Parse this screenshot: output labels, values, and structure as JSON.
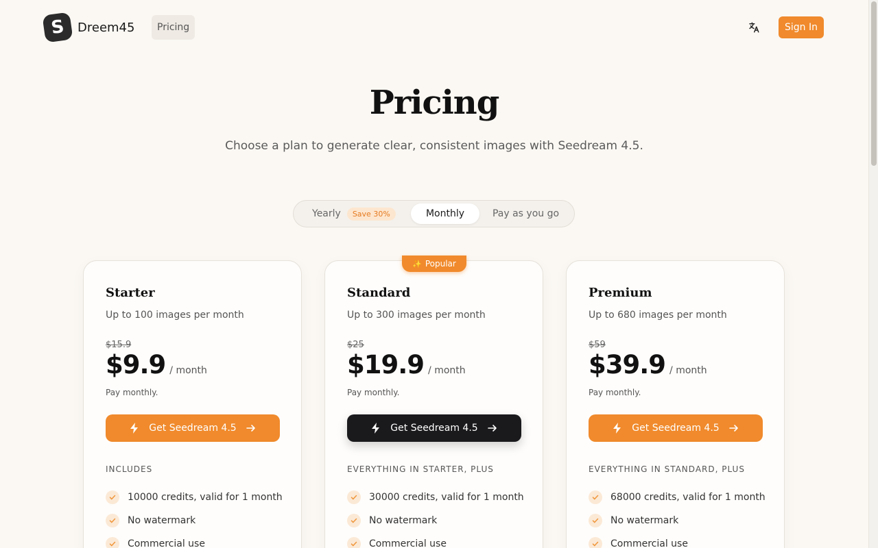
{
  "brand": {
    "logo_letter": "S",
    "name": "Dreem45"
  },
  "nav": {
    "pricing": "Pricing",
    "sign_in": "Sign In",
    "translate_icon": "translate-icon"
  },
  "hero": {
    "title": "Pricing",
    "subtitle": "Choose a plan to generate clear, consistent images with Seedream 4.5."
  },
  "billing_toggle": {
    "yearly": "Yearly",
    "save_badge": "Save 30%",
    "monthly": "Monthly",
    "payg": "Pay as you go",
    "selected": "Monthly"
  },
  "colors": {
    "accent": "#f08a2c",
    "dark_button": "#1a1a1d",
    "background": "#fbf8f3"
  },
  "plans": [
    {
      "name": "Starter",
      "desc": "Up to 100 images per month",
      "old_price": "$15.9",
      "price": "$9.9",
      "per": "/ month",
      "billing_note": "Pay monthly.",
      "cta": "Get Seedream 4.5",
      "includes_title": "INCLUDES",
      "features": [
        "10000 credits, valid for 1 month",
        "No watermark",
        "Commercial use"
      ]
    },
    {
      "name": "Standard",
      "badge": "Popular",
      "desc": "Up to 300 images per month",
      "old_price": "$25",
      "price": "$19.9",
      "per": "/ month",
      "billing_note": "Pay monthly.",
      "cta": "Get Seedream 4.5",
      "includes_title": "EVERYTHING IN STARTER, PLUS",
      "features": [
        "30000 credits, valid for 1 month",
        "No watermark",
        "Commercial use"
      ]
    },
    {
      "name": "Premium",
      "desc": "Up to 680 images per month",
      "old_price": "$59",
      "price": "$39.9",
      "per": "/ month",
      "billing_note": "Pay monthly.",
      "cta": "Get Seedream 4.5",
      "includes_title": "EVERYTHING IN STANDARD, PLUS",
      "features": [
        "68000 credits, valid for 1 month",
        "No watermark",
        "Commercial use"
      ]
    }
  ]
}
